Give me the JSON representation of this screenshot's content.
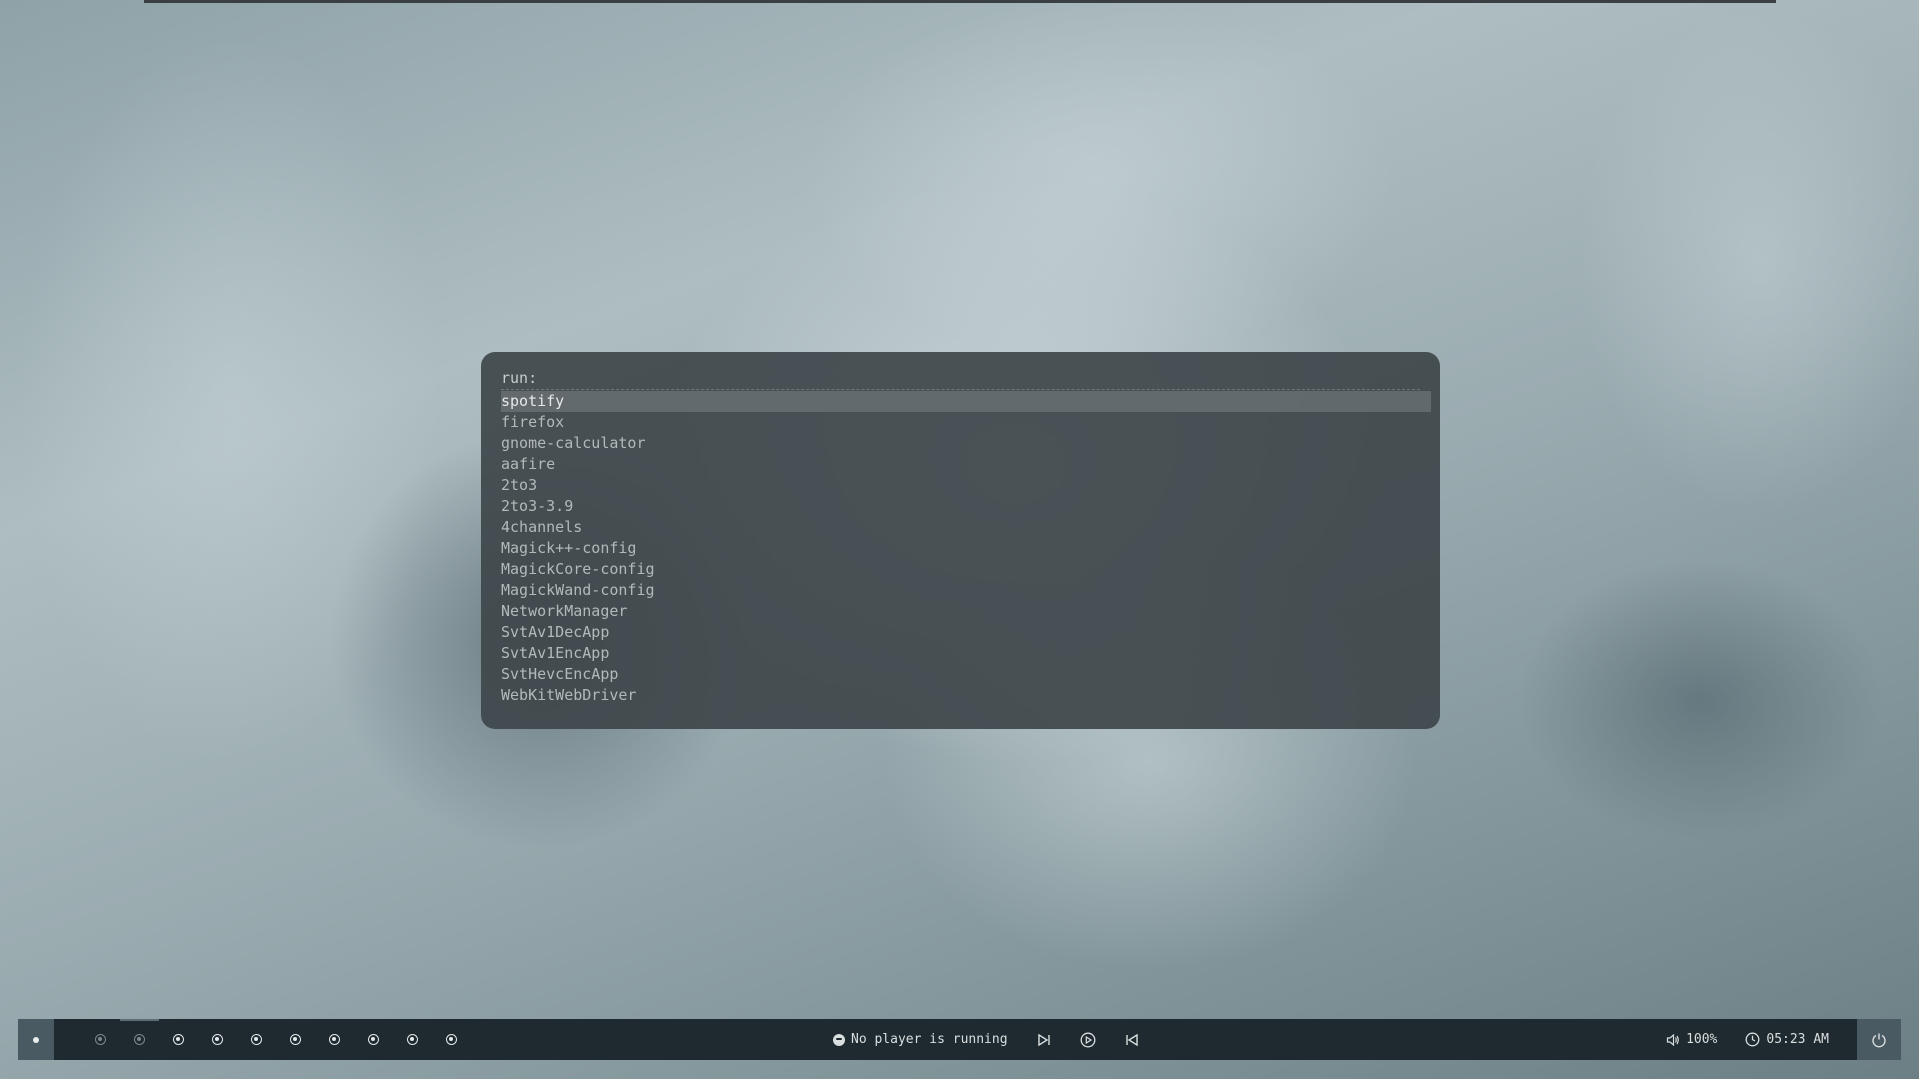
{
  "launcher": {
    "prompt": "run:",
    "results": [
      "spotify",
      "firefox",
      "gnome-calculator",
      "aafire",
      "2to3",
      "2to3-3.9",
      "4channels",
      "Magick++-config",
      "MagickCore-config",
      "MagickWand-config",
      "NetworkManager",
      "SvtAv1DecApp",
      "SvtAv1EncApp",
      "SvtHevcEncApp",
      "WebKitWebDriver"
    ],
    "selected_index": 0
  },
  "bar": {
    "workspace_count": 10,
    "active_workspace": 2,
    "media": {
      "status": "No player is running",
      "icon": "spotify-icon"
    },
    "volume": "100%",
    "clock": "05:23 AM",
    "icons": {
      "next": "skip-forward-icon",
      "play": "play-icon",
      "prev": "skip-back-icon",
      "volume": "volume-icon",
      "clock": "clock-icon",
      "power": "power-icon"
    }
  },
  "colors": {
    "bar_bg": "#1f2a30",
    "accent": "#4a5a62",
    "launcher_bg": "#3e464a"
  }
}
